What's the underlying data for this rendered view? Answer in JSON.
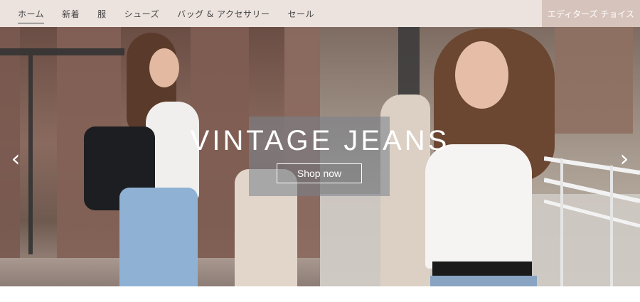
{
  "nav": {
    "items": [
      {
        "label": "ホーム",
        "active": true
      },
      {
        "label": "新着",
        "active": false
      },
      {
        "label": "服",
        "active": false
      },
      {
        "label": "シューズ",
        "active": false
      },
      {
        "label": "バッグ & アクセサリー",
        "active": false
      },
      {
        "label": "セール",
        "active": false
      }
    ],
    "editors_choice": "エディターズ チョイス"
  },
  "hero": {
    "title": "VINTAGE JEANS",
    "cta": "Shop now",
    "prev_icon": "chevron-left-icon",
    "next_icon": "chevron-right-icon"
  },
  "colors": {
    "nav_background": "#ece3df",
    "editors_background": "#d6c3bb",
    "hero_text": "#ffffff"
  }
}
